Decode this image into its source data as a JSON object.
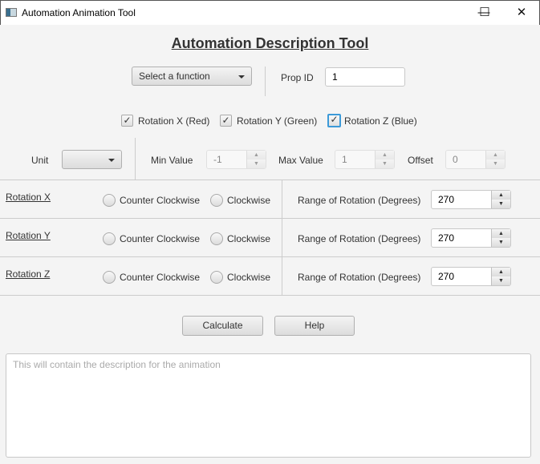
{
  "window": {
    "title": "Automation Animation Tool",
    "minimize": "—",
    "maximize": "☐",
    "close": "✕"
  },
  "header": {
    "title": "Automation Description Tool"
  },
  "function_select": {
    "value": "Select a function"
  },
  "prop_id": {
    "label": "Prop ID",
    "value": "1"
  },
  "checkboxes": [
    {
      "label": "Rotation X (Red)",
      "checked": true
    },
    {
      "label": "Rotation Y (Green)",
      "checked": true
    },
    {
      "label": "Rotation Z (Blue)",
      "checked": true
    }
  ],
  "unit": {
    "label": "Unit",
    "value": ""
  },
  "min": {
    "label": "Min Value",
    "value": "-1"
  },
  "max": {
    "label": "Max Value",
    "value": "1"
  },
  "offset": {
    "label": "Offset",
    "value": "0"
  },
  "rows": [
    {
      "name": "Rotation X",
      "ccw": "Counter Clockwise",
      "cw": "Clockwise",
      "range_label": "Range of Rotation (Degrees)",
      "range": "270"
    },
    {
      "name": "Rotation Y",
      "ccw": "Counter Clockwise",
      "cw": "Clockwise",
      "range_label": "Range of Rotation (Degrees)",
      "range": "270"
    },
    {
      "name": "Rotation Z",
      "ccw": "Counter Clockwise",
      "cw": "Clockwise",
      "range_label": "Range of Rotation (Degrees)",
      "range": "270"
    }
  ],
  "buttons": {
    "calculate": "Calculate",
    "help": "Help"
  },
  "description": {
    "placeholder": "This will contain the description for the animation",
    "value": ""
  },
  "spin_up": "▲",
  "spin_down": "▼",
  "check": "✓"
}
